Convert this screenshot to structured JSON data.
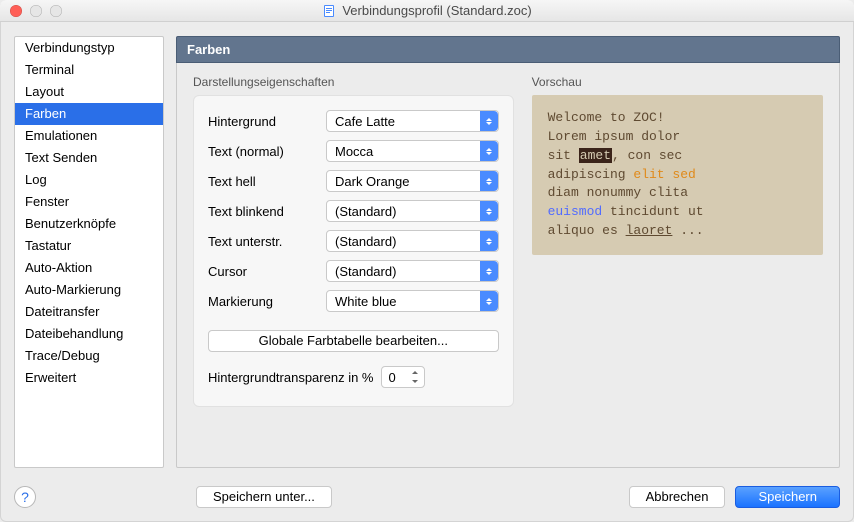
{
  "window": {
    "title": "Verbindungsprofil (Standard.zoc)"
  },
  "sidebar": {
    "items": [
      {
        "label": "Verbindungstyp"
      },
      {
        "label": "Terminal"
      },
      {
        "label": "Layout"
      },
      {
        "label": "Farben",
        "selected": true
      },
      {
        "label": "Emulationen"
      },
      {
        "label": "Text Senden"
      },
      {
        "label": "Log"
      },
      {
        "label": "Fenster"
      },
      {
        "label": "Benutzerknöpfe"
      },
      {
        "label": "Tastatur"
      },
      {
        "label": "Auto-Aktion"
      },
      {
        "label": "Auto-Markierung"
      },
      {
        "label": "Dateitransfer"
      },
      {
        "label": "Dateibehandlung"
      },
      {
        "label": "Trace/Debug"
      },
      {
        "label": "Erweitert"
      }
    ]
  },
  "main": {
    "header": "Farben",
    "props_title": "Darstellungseigenschaften",
    "preview_title": "Vorschau",
    "rows": {
      "background": {
        "label": "Hintergrund",
        "value": "Cafe Latte"
      },
      "text_normal": {
        "label": "Text (normal)",
        "value": "Mocca"
      },
      "text_bright": {
        "label": "Text hell",
        "value": "Dark Orange"
      },
      "text_blink": {
        "label": "Text blinkend",
        "value": "(Standard)"
      },
      "text_under": {
        "label": "Text unterstr.",
        "value": "(Standard)"
      },
      "cursor": {
        "label": "Cursor",
        "value": "(Standard)"
      },
      "selection": {
        "label": "Markierung",
        "value": "White blue"
      }
    },
    "global_btn": "Globale Farbtabelle bearbeiten...",
    "transparency": {
      "label": "Hintergrundtransparenz in %",
      "value": "0"
    }
  },
  "preview": {
    "l1": "Welcome to ZOC!",
    "l2a": "Lorem ipsum dolor",
    "l3a": "sit ",
    "l3b": "amet",
    "l3c": ", con sec",
    "l4a": "adipiscing ",
    "l4b": "elit sed",
    "l5": "diam nonummy clita",
    "l6a": "euismod",
    "l6b": " tincidunt ut",
    "l7a": "aliquo es ",
    "l7b": "laoret",
    "l7c": " ..."
  },
  "footer": {
    "save_as": "Speichern unter...",
    "cancel": "Abbrechen",
    "save": "Speichern"
  }
}
